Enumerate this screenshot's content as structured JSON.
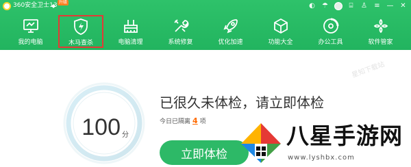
{
  "window": {
    "title": "360安全卫士13",
    "badge": "升级",
    "dot": "◆",
    "controls": [
      "theme-icon",
      "skin-icon",
      "avatar",
      "feedback-icon",
      "shirt-icon",
      "menu-icon",
      "minimize-icon",
      "close-icon"
    ],
    "control_glyphs": {
      "theme": "◐",
      "skin": "☂",
      "feedback": "⌸",
      "shirt": "♙",
      "menu": "≡",
      "minimize": "—",
      "close": "✕"
    }
  },
  "nav": {
    "items": [
      {
        "label": "我的电脑",
        "icon": "monitor-icon",
        "active": false
      },
      {
        "label": "木马查杀",
        "icon": "shield-lightning-icon",
        "active": true
      },
      {
        "label": "电脑清理",
        "icon": "broom-icon",
        "active": false
      },
      {
        "label": "系统修复",
        "icon": "wrench-icon",
        "active": false
      },
      {
        "label": "优化加速",
        "icon": "rocket-icon",
        "active": false
      },
      {
        "label": "功能大全",
        "icon": "cube-icon",
        "active": false
      },
      {
        "label": "办公工具",
        "icon": "circle-arc-icon",
        "active": false
      },
      {
        "label": "软件管家",
        "icon": "flower-grid-icon",
        "active": false
      }
    ]
  },
  "main": {
    "watermark": "星知下载站",
    "score": {
      "value": "100",
      "unit": "分"
    },
    "headline": "已很久未体检，请立即体检",
    "status": {
      "prefix": "今日已隔离",
      "count": "4",
      "suffix": "项"
    },
    "check_button": "立即体检"
  },
  "site": {
    "name": "八星手游网",
    "url": "www.lyshbx.com"
  },
  "colors": {
    "brand_green": "#22b45f",
    "button_green": "#2db967",
    "active_border": "#e53935",
    "count_orange": "#ff6a00"
  }
}
